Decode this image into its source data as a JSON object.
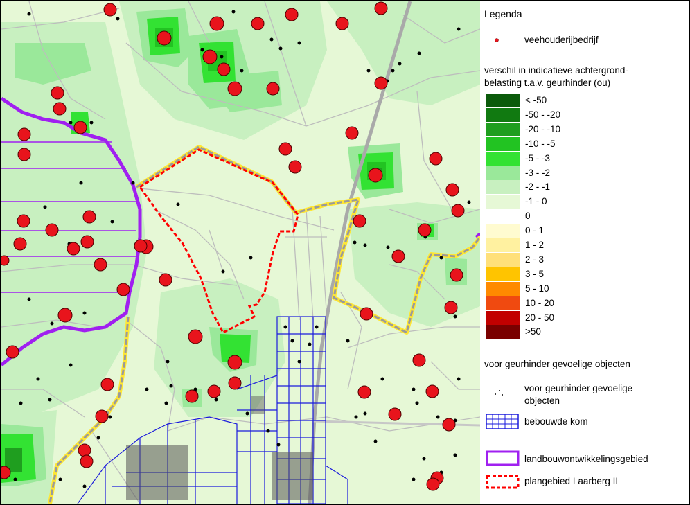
{
  "legend": {
    "title": "Legenda",
    "farm_label": "veehouderijbedrijf",
    "ramp_title_line1": "verschil in indicatieve achtergrond-",
    "ramp_title_line2": "belasting t.a.v. geurhinder (ou)",
    "ramp": [
      {
        "label": "< -50",
        "color": "#0b5a0b"
      },
      {
        "label": "-50 - -20",
        "color": "#117a11"
      },
      {
        "label": "-20 - -10",
        "color": "#1f9e1f"
      },
      {
        "label": "-10 - -5",
        "color": "#22c322"
      },
      {
        "label": "-5 - -3",
        "color": "#33e233"
      },
      {
        "label": "-3 - -2",
        "color": "#9ae89a"
      },
      {
        "label": "-2 - -1",
        "color": "#c8f0c0"
      },
      {
        "label": "-1 - 0",
        "color": "#e6f8d6"
      },
      {
        "label": "0",
        "color": "#ffffff"
      },
      {
        "label": "0 - 1",
        "color": "#fffbd0"
      },
      {
        "label": "1 - 2",
        "color": "#fff1a0"
      },
      {
        "label": "2 - 3",
        "color": "#ffe07a"
      },
      {
        "label": "3 - 5",
        "color": "#ffc400"
      },
      {
        "label": "5 - 10",
        "color": "#ff8a00"
      },
      {
        "label": "10 - 20",
        "color": "#f04a10"
      },
      {
        "label": "20 - 50",
        "color": "#c20000"
      },
      {
        "label": ">50",
        "color": "#7a0000"
      }
    ],
    "sensitive_title": "voor geurhinder gevoelige objecten",
    "sensitive_label_line1": "voor geurhinder gevoelige",
    "sensitive_label_line2": "objecten",
    "built_area_label": "bebouwde kom",
    "agri_zone_label": "landbouwontwikkelingsgebied",
    "plan_area_label": "plangebied Laarberg II"
  },
  "colors": {
    "farm": "#e8141c",
    "agri_zone": "#a020f0",
    "built_area": "#1a1adc",
    "plan_area": "#ff0000",
    "border_yellow": "#ffe733",
    "border_gray": "#9a9a9a",
    "road": "#bdbdbd"
  }
}
